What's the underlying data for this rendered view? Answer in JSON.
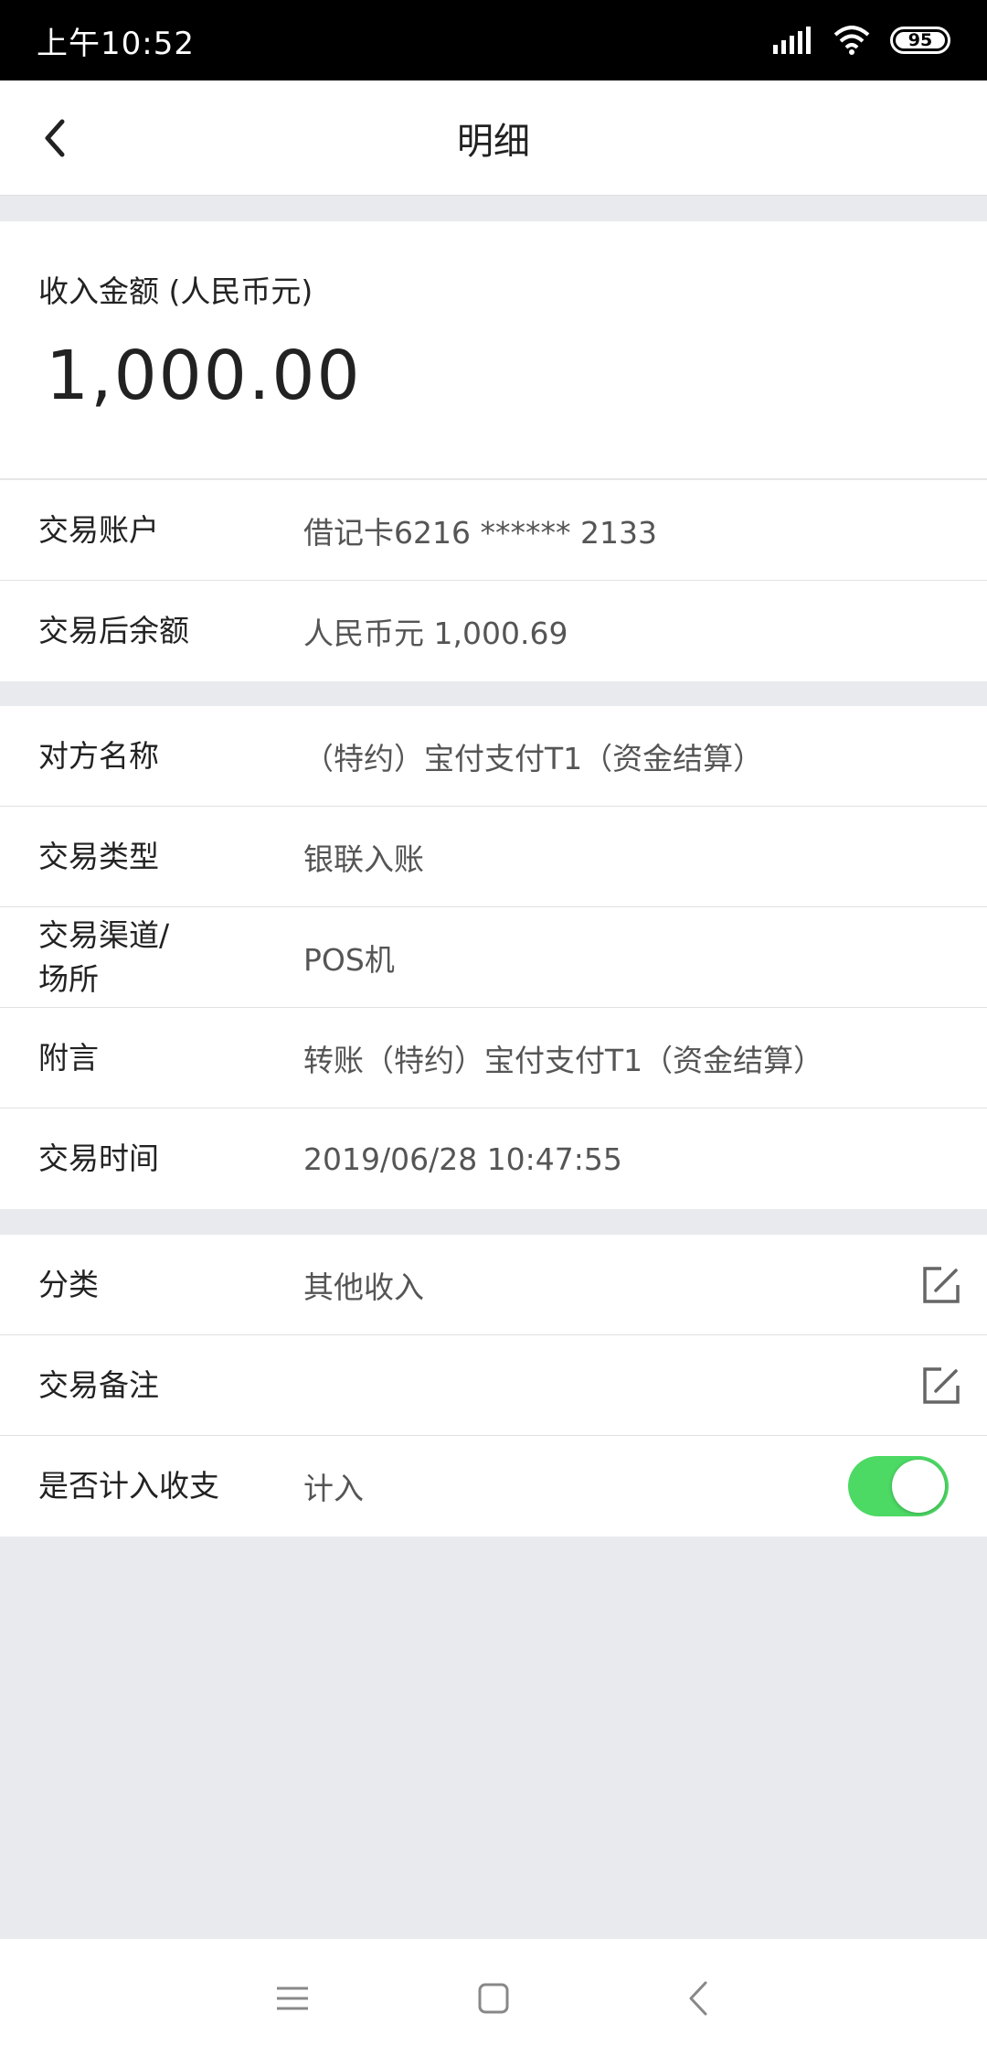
{
  "status_bar": {
    "time": "上午10:52",
    "battery": "95",
    "icons": [
      "signal-icon",
      "wifi-icon",
      "battery-icon"
    ]
  },
  "nav": {
    "title": "明细",
    "back_icon": "chevron-left-icon"
  },
  "amount": {
    "label": "收入金额 (人民币元)",
    "value": "1,000.00"
  },
  "account_section": {
    "rows": [
      {
        "label": "交易账户",
        "value": "借记卡6216 ****** 2133"
      },
      {
        "label": "交易后余额",
        "value": "人民币元 1,000.69"
      }
    ]
  },
  "details_section": {
    "rows": [
      {
        "label": "对方名称",
        "value": "（特约）宝付支付T1（资金结算）"
      },
      {
        "label": "交易类型",
        "value": "银联入账"
      },
      {
        "label": "交易渠道/\n场所",
        "value": "POS机"
      },
      {
        "label": "附言",
        "value": "转账（特约）宝付支付T1（资金结算）"
      },
      {
        "label": "交易时间",
        "value": "2019/06/28 10:47:55"
      }
    ]
  },
  "edit_section": {
    "category": {
      "label": "分类",
      "value": "其他收入",
      "icon": "edit-icon"
    },
    "note": {
      "label": "交易备注",
      "value": "",
      "icon": "edit-icon"
    },
    "include": {
      "label": "是否计入收支",
      "value": "计入",
      "toggle_on": true
    }
  },
  "system_nav": {
    "icons": [
      "menu-icon",
      "home-icon",
      "back-icon"
    ]
  },
  "colors": {
    "toggle_on": "#4cd964",
    "background": "#e8eaed"
  }
}
